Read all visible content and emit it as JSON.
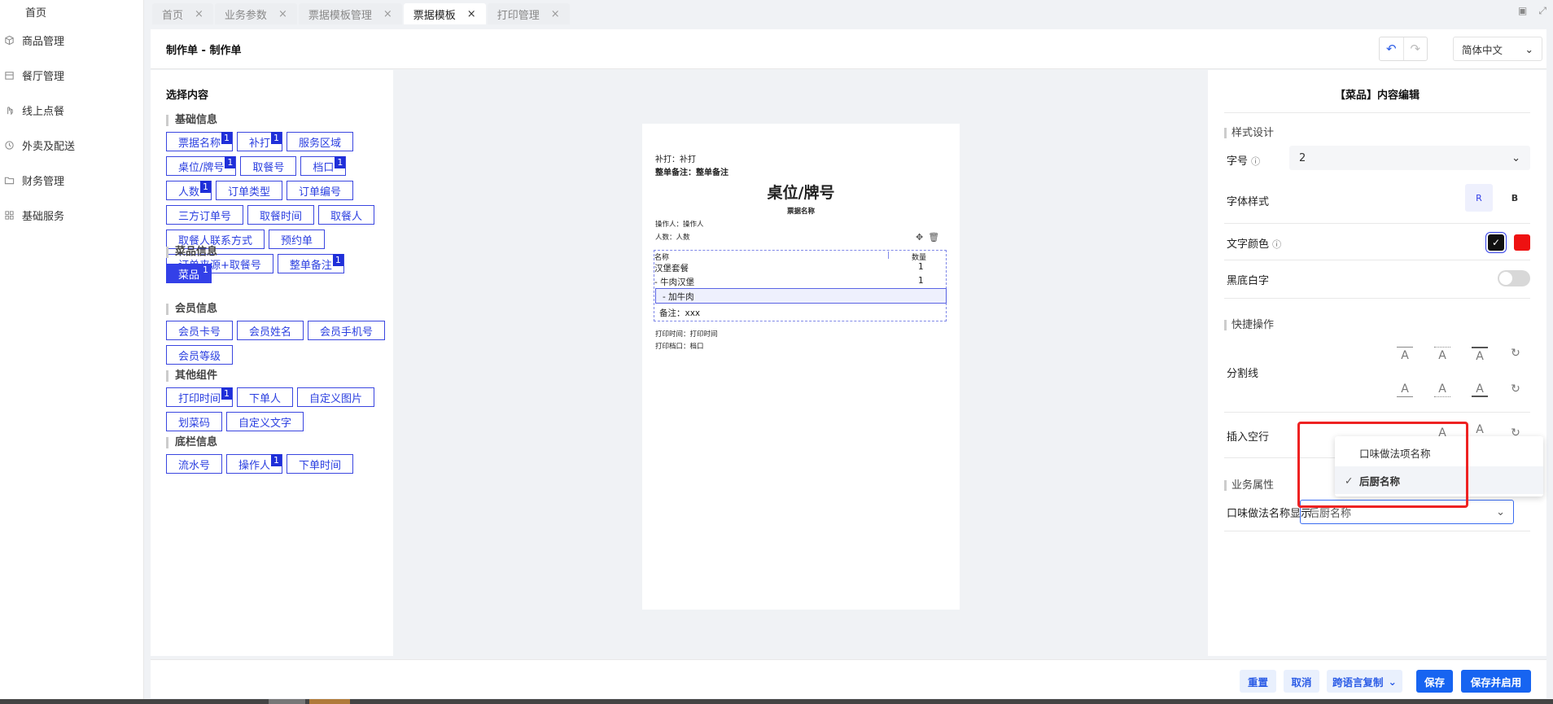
{
  "nav": {
    "items": [
      {
        "label": "首页",
        "icon": "home-icon"
      },
      {
        "label": "商品管理",
        "icon": "cube-icon"
      },
      {
        "label": "餐厅管理",
        "icon": "store-icon"
      },
      {
        "label": "线上点餐",
        "icon": "hand-icon"
      },
      {
        "label": "外卖及配送",
        "icon": "delivery-icon"
      },
      {
        "label": "财务管理",
        "icon": "folder-icon"
      },
      {
        "label": "基础服务",
        "icon": "grid-icon"
      }
    ]
  },
  "tabs": [
    {
      "label": "首页",
      "active": false
    },
    {
      "label": "业务参数",
      "active": false
    },
    {
      "label": "票据模板管理",
      "active": false
    },
    {
      "label": "票据模板",
      "active": true
    },
    {
      "label": "打印管理",
      "active": false
    }
  ],
  "header": {
    "title": "制作单 - 制作单",
    "language": "简体中文"
  },
  "content_panel": {
    "title": "选择内容",
    "sections": [
      {
        "title": "基础信息",
        "chips": [
          {
            "label": "票据名称",
            "badge": "1"
          },
          {
            "label": "补打",
            "badge": "1"
          },
          {
            "label": "服务区域",
            "badge": ""
          },
          {
            "label": "桌位/牌号",
            "badge": "1"
          },
          {
            "label": "取餐号",
            "badge": ""
          },
          {
            "label": "档口",
            "badge": "1"
          },
          {
            "label": "人数",
            "badge": "1"
          },
          {
            "label": "订单类型",
            "badge": ""
          },
          {
            "label": "订单编号",
            "badge": ""
          },
          {
            "label": "三方订单号",
            "badge": ""
          },
          {
            "label": "取餐时间",
            "badge": ""
          },
          {
            "label": "取餐人",
            "badge": ""
          },
          {
            "label": "取餐人联系方式",
            "badge": ""
          },
          {
            "label": "预约单",
            "badge": ""
          },
          {
            "label": "订单来源+取餐号",
            "badge": ""
          },
          {
            "label": "整单备注",
            "badge": "1"
          }
        ]
      },
      {
        "title": "菜品信息",
        "chips": [
          {
            "label": "菜品",
            "badge": "1",
            "active": true
          }
        ]
      },
      {
        "title": "会员信息",
        "chips": [
          {
            "label": "会员卡号",
            "badge": ""
          },
          {
            "label": "会员姓名",
            "badge": ""
          },
          {
            "label": "会员手机号",
            "badge": ""
          },
          {
            "label": "会员等级",
            "badge": ""
          }
        ]
      },
      {
        "title": "其他组件",
        "chips": [
          {
            "label": "打印时间",
            "badge": "1"
          },
          {
            "label": "下单人",
            "badge": ""
          },
          {
            "label": "自定义图片",
            "badge": ""
          },
          {
            "label": "划菜码",
            "badge": ""
          },
          {
            "label": "自定义文字",
            "badge": ""
          }
        ]
      },
      {
        "title": "底栏信息",
        "chips": [
          {
            "label": "流水号",
            "badge": ""
          },
          {
            "label": "操作人",
            "badge": "1"
          },
          {
            "label": "下单时间",
            "badge": ""
          }
        ]
      }
    ]
  },
  "receipt": {
    "reprint": "补打：补打",
    "order_remark": "整单备注：整单备注",
    "title": "桌位/牌号",
    "subtitle": "票据名称",
    "operator": "操作人：操作人",
    "guests": "人数：人数",
    "table_header_name": "名称",
    "table_header_qty": "数量",
    "rows": [
      {
        "name": "汉堡套餐",
        "qty": "1"
      },
      {
        "name": "- 牛肉汉堡",
        "qty": "1"
      }
    ],
    "addon": "- 加牛肉",
    "note": "备注：xxx",
    "print_time": "打印时间：打印时间",
    "print_stall": "打印档口：档口"
  },
  "right_panel": {
    "title": "【菜品】内容编辑",
    "style_section": "样式设计",
    "font_size_label": "字号",
    "font_size_value": "2",
    "font_style_label": "字体样式",
    "font_style_regular": "R",
    "font_style_bold": "B",
    "text_color_label": "文字颜色",
    "colors": {
      "black": "#111111",
      "red": "#ee1111"
    },
    "invert_label": "黑底白字",
    "quick_section": "快捷操作",
    "divider_label": "分割线",
    "blank_line_label": "插入空行",
    "biz_section": "业务属性",
    "flavor_label": "口味做法名称显示",
    "flavor_value": "后厨名称",
    "sep_glyph": "A"
  },
  "dropdown": {
    "options": [
      {
        "label": "口味做法项名称",
        "selected": false
      },
      {
        "label": "后厨名称",
        "selected": true
      }
    ]
  },
  "footer": {
    "reset": "重置",
    "cancel": "取消",
    "copy_lang": "跨语言复制",
    "save": "保存",
    "save_enable": "保存并启用"
  }
}
